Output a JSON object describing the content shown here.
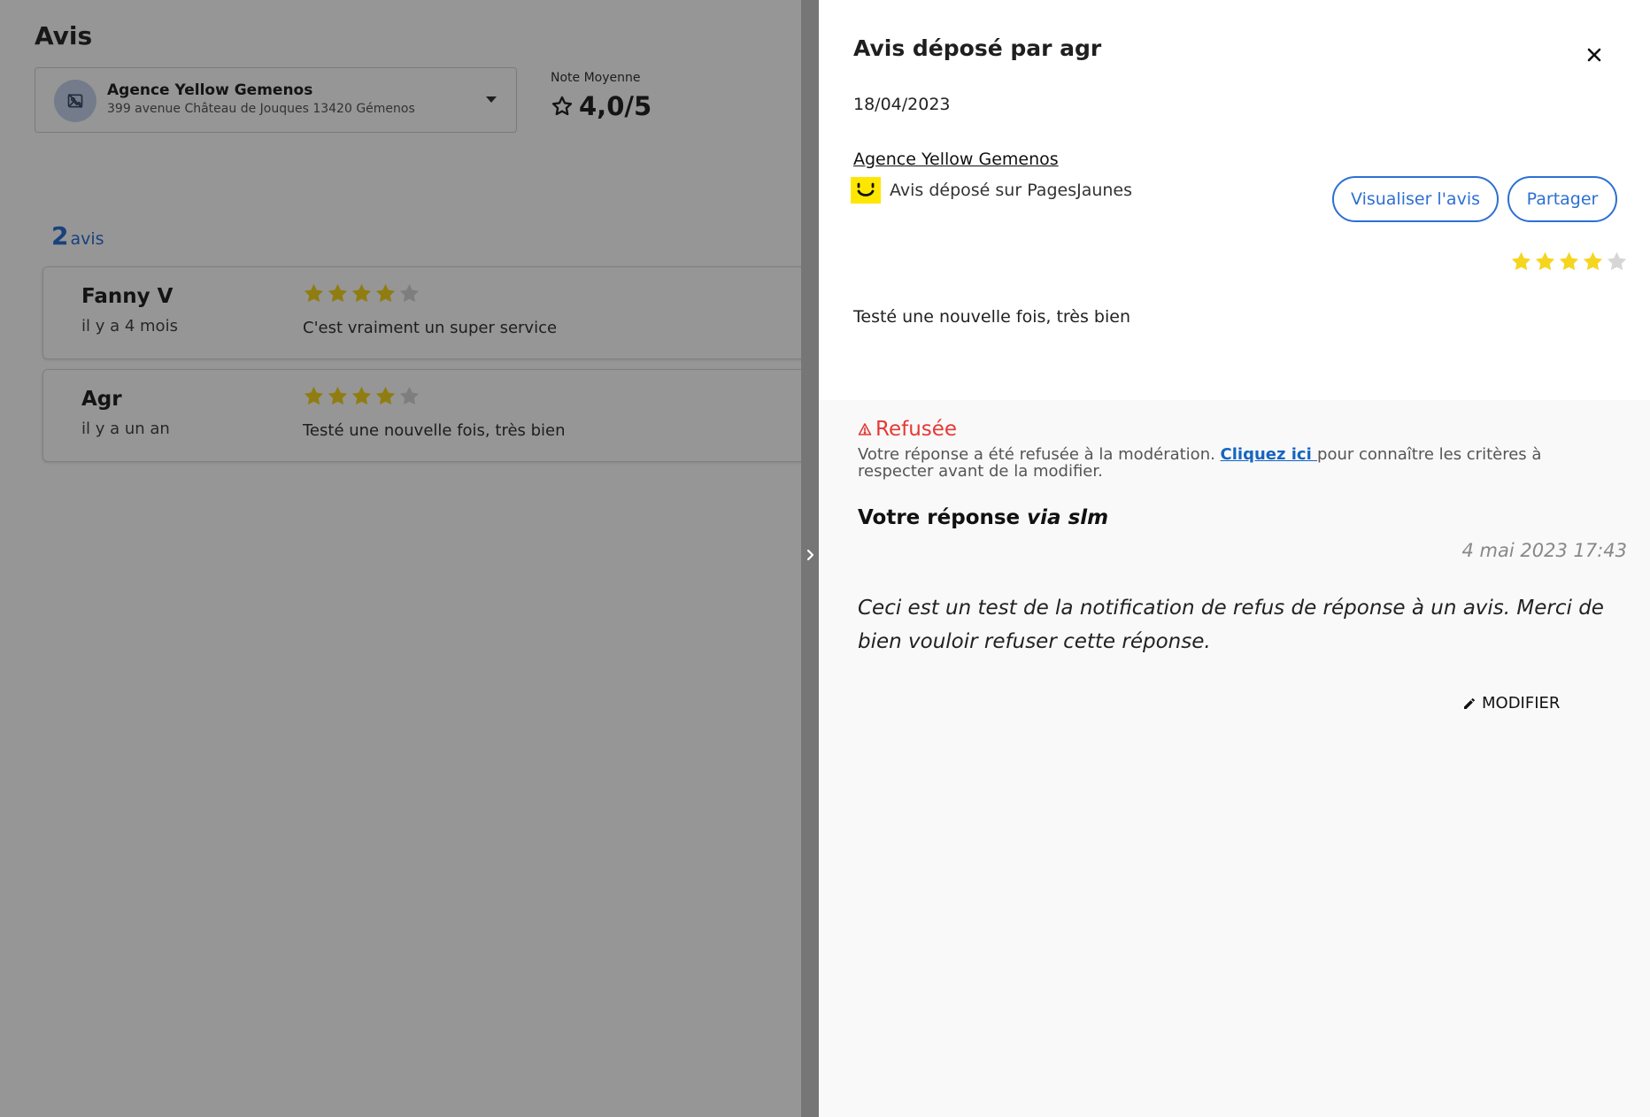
{
  "page": {
    "title": "Avis",
    "agency_select": {
      "name": "Agence Yellow Gemenos",
      "address": "399 avenue Château de Jouques 13420 Gémenos",
      "avatar_icon": "image-placeholder-icon",
      "dropdown_icon": "caret-down-icon"
    },
    "average": {
      "label": "Note Moyenne",
      "value": "4,0/5",
      "icon": "star-outline-icon"
    },
    "count": {
      "number": "2",
      "label": "avis"
    },
    "reviews": [
      {
        "author": "Fanny V",
        "date": "il y a 4 mois",
        "rating": 4,
        "max_rating": 5,
        "text": "C'est vraiment un super service"
      },
      {
        "author": "Agr",
        "date": "il y a un an",
        "rating": 4,
        "max_rating": 5,
        "text": "Testé une nouvelle fois, très bien"
      }
    ]
  },
  "splitter": {
    "icon": "chevron-right-icon"
  },
  "drawer": {
    "title": "Avis déposé par agr",
    "close_icon": "close-icon",
    "date": "18/04/2023",
    "agency_link": "Agence Yellow Gemenos",
    "source_logo": "pagesjaunes-logo",
    "source_text": "Avis déposé sur PagesJaunes",
    "view_button": "Visualiser l'avis",
    "share_button": "Partager",
    "rating": 4,
    "max_rating": 5,
    "review_text": "Testé une nouvelle fois, très bien",
    "response": {
      "status": "Refusée",
      "status_icon": "warning-icon",
      "note_before": "Votre réponse a été refusée à la modération. ",
      "note_link": "Cliquez ici ",
      "note_after": "pour connaître les critères à respecter avant de la modifier.",
      "heading_prefix": "Votre réponse ",
      "heading_via": "via slm",
      "date": "4 mai 2023 17:43",
      "text": "Ceci est un test de la notification de refus de réponse à un avis. Merci de bien vouloir refuser cette réponse.",
      "modify_label": "MODIFIER",
      "modify_icon": "pencil-icon"
    }
  },
  "colors": {
    "accent": "#2d6fd3",
    "star_filled": "#f5d51e",
    "star_empty": "#d6d6d6",
    "refused": "#e53935",
    "pagesjaunes_yellow": "#ffe600"
  }
}
